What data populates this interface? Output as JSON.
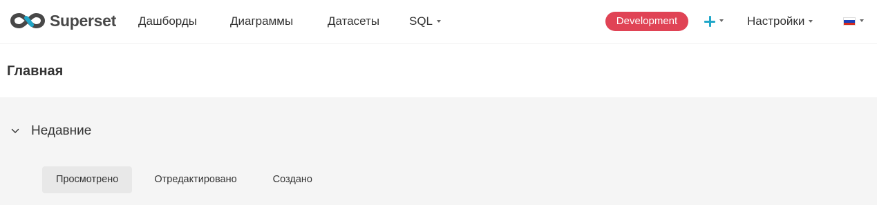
{
  "brand": {
    "name": "Superset",
    "logo_icon": "superset-logo-icon"
  },
  "nav": {
    "dashboards": "Дашборды",
    "charts": "Диаграммы",
    "datasets": "Датасеты",
    "sql": "SQL",
    "environment": "Development",
    "settings": "Настройки",
    "language_flag_icon": "russia-flag-icon"
  },
  "colors": {
    "environment_badge": "#e04355",
    "plus_icon": "#20a7c9",
    "content_background": "#f5f5f5",
    "active_tab_background": "#e8e8e8"
  },
  "page": {
    "title": "Главная"
  },
  "recents": {
    "section_title": "Недавние",
    "expanded": true,
    "tabs": [
      {
        "label": "Просмотрено",
        "active": true
      },
      {
        "label": "Отредактировано",
        "active": false
      },
      {
        "label": "Создано",
        "active": false
      }
    ]
  }
}
